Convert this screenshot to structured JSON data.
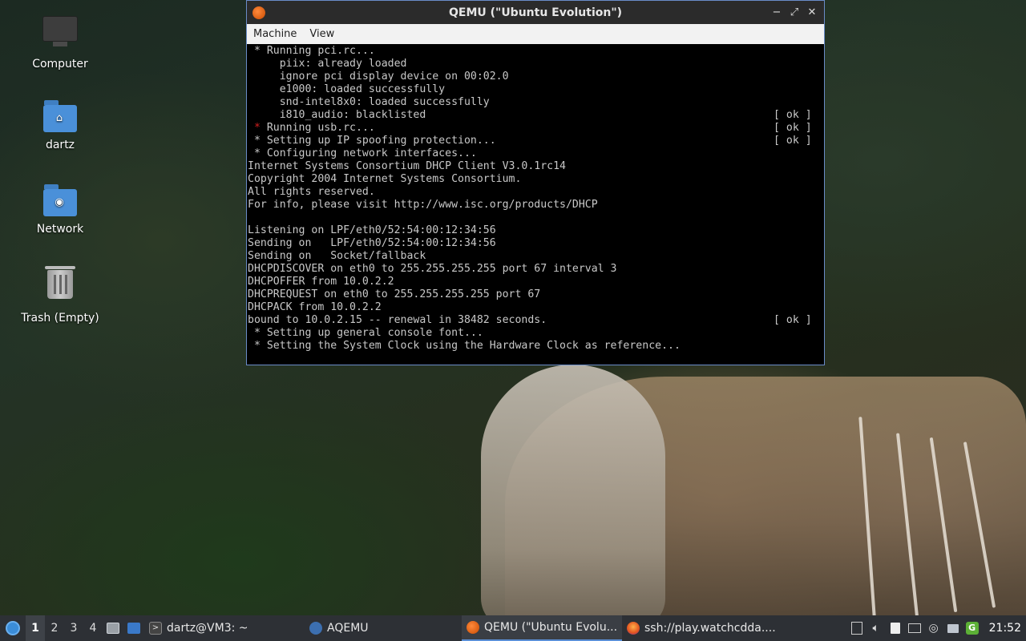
{
  "desktop": {
    "icons": [
      {
        "label": "Computer",
        "icon": "computer-icon"
      },
      {
        "label": "dartz",
        "icon": "home-folder-icon"
      },
      {
        "label": "Network",
        "icon": "network-folder-icon"
      },
      {
        "label": "Trash (Empty)",
        "icon": "trash-icon"
      }
    ]
  },
  "qemu_window": {
    "title": "QEMU (\"Ubuntu Evolution\")",
    "menu": [
      "Machine",
      "View"
    ],
    "controls": {
      "minimize": "−",
      "maximize": "⤢",
      "close": "✕"
    },
    "console_lines": [
      {
        "text": " * Running pci.rc...",
        "ok": ""
      },
      {
        "text": "     piix: already loaded",
        "ok": ""
      },
      {
        "text": "     ignore pci display device on 00:02.0",
        "ok": ""
      },
      {
        "text": "     e1000: loaded successfully",
        "ok": ""
      },
      {
        "text": "     snd-intel8x0: loaded successfully",
        "ok": ""
      },
      {
        "text": "     i810_audio: blacklisted",
        "ok": "[ ok ]"
      },
      {
        "text": " * Running usb.rc...",
        "ok": "[ ok ]",
        "red_star": true
      },
      {
        "text": " * Setting up IP spoofing protection...",
        "ok": "[ ok ]"
      },
      {
        "text": " * Configuring network interfaces...",
        "ok": ""
      },
      {
        "text": "Internet Systems Consortium DHCP Client V3.0.1rc14",
        "ok": ""
      },
      {
        "text": "Copyright 2004 Internet Systems Consortium.",
        "ok": ""
      },
      {
        "text": "All rights reserved.",
        "ok": ""
      },
      {
        "text": "For info, please visit http://www.isc.org/products/DHCP",
        "ok": ""
      },
      {
        "text": "",
        "ok": ""
      },
      {
        "text": "Listening on LPF/eth0/52:54:00:12:34:56",
        "ok": ""
      },
      {
        "text": "Sending on   LPF/eth0/52:54:00:12:34:56",
        "ok": ""
      },
      {
        "text": "Sending on   Socket/fallback",
        "ok": ""
      },
      {
        "text": "DHCPDISCOVER on eth0 to 255.255.255.255 port 67 interval 3",
        "ok": ""
      },
      {
        "text": "DHCPOFFER from 10.0.2.2",
        "ok": ""
      },
      {
        "text": "DHCPREQUEST on eth0 to 255.255.255.255 port 67",
        "ok": ""
      },
      {
        "text": "DHCPACK from 10.0.2.2",
        "ok": ""
      },
      {
        "text": "bound to 10.0.2.15 -- renewal in 38482 seconds.",
        "ok": "[ ok ]"
      },
      {
        "text": " * Setting up general console font...",
        "ok": ""
      },
      {
        "text": " * Setting the System Clock using the Hardware Clock as reference...",
        "ok": ""
      }
    ]
  },
  "taskbar": {
    "workspaces": [
      "1",
      "2",
      "3",
      "4"
    ],
    "active_workspace": "1",
    "tasks": [
      {
        "label": "dartz@VM3: ~",
        "icon": "terminal-icon",
        "active": false
      },
      {
        "label": "AQEMU",
        "icon": "aqemu-icon",
        "active": false
      },
      {
        "label": "QEMU (\"Ubuntu Evolu...",
        "icon": "qemu-icon",
        "active": true
      },
      {
        "label": "ssh://play.watchcdda....",
        "icon": "firefox-icon",
        "active": false
      }
    ],
    "clock": "21:52"
  },
  "colors": {
    "taskbar_bg": "#2d3035",
    "titlebar_bg": "#2b2b2b",
    "window_border": "#6a8cc8",
    "console_fg": "#c8c8c8",
    "console_bg": "#000000"
  }
}
